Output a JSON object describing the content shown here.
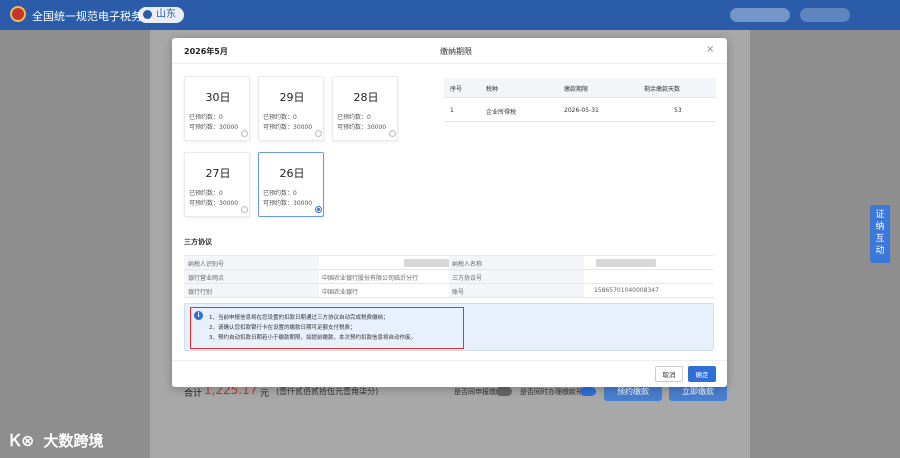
{
  "app": {
    "title": "全国统一规范电子税务局",
    "region": "山东"
  },
  "side_tab": {
    "label": "证 纳 互 动"
  },
  "footer": {
    "total_label": "合计",
    "total_value": "1,225.17",
    "total_unit": "元",
    "total_note": "(壹仟贰佰贰拾伍元壹角柒分)",
    "toggle_1_label": "是否同申报缴款",
    "toggle_2_label": "是否同时办理缴款预约",
    "btn_1": "预约缴款",
    "btn_2": "立即缴款"
  },
  "watermark": {
    "logo": "Ꮶ⊗",
    "text": "大数跨境"
  },
  "modal": {
    "month": "2026年5月",
    "title": "缴纳期限",
    "close": "×",
    "stat1_label": "已预约数：",
    "stat2_label": "可预约数：",
    "dates": [
      {
        "day": "30日",
        "booked": "0",
        "available": "30000",
        "selected": false
      },
      {
        "day": "29日",
        "booked": "0",
        "available": "30000",
        "selected": false
      },
      {
        "day": "28日",
        "booked": "0",
        "available": "30000",
        "selected": false
      },
      {
        "day": "27日",
        "booked": "0",
        "available": "30000",
        "selected": false
      },
      {
        "day": "26日",
        "booked": "0",
        "available": "30000",
        "selected": true
      }
    ],
    "deadline_table": {
      "headers": [
        "序号",
        "税种",
        "缴款期限",
        "剩余缴款天数"
      ],
      "rows": [
        [
          "1",
          "企业所得税",
          "2026-05-31",
          "53"
        ]
      ]
    },
    "agreement": {
      "title": "三方协议",
      "rows": [
        {
          "l1": "纳税人识别号",
          "v1": "",
          "l2": "纳税人名称",
          "v2": ""
        },
        {
          "l1": "银行营业网点",
          "v1": "中国农业银行股份有限公司临沂分行",
          "l2": "三方协议号",
          "v2": ""
        },
        {
          "l1": "银行行别",
          "v1": "中国农业银行",
          "l2": "账号",
          "v2": "15865701040008347"
        }
      ]
    },
    "notice": {
      "icon": "i",
      "lines": [
        "1、当前申报信息将在您设置的扣款日期通过三方协议自动完成税费缴纳；",
        "2、请确认您扣款银行卡在设置的缴款日期可足额支付税费；",
        "3、预约自动扣款日期若小于缴款期限，如提前缴款，本次预约扣款信息将自动作废。"
      ]
    },
    "cancel": "取消",
    "confirm": "确定"
  }
}
